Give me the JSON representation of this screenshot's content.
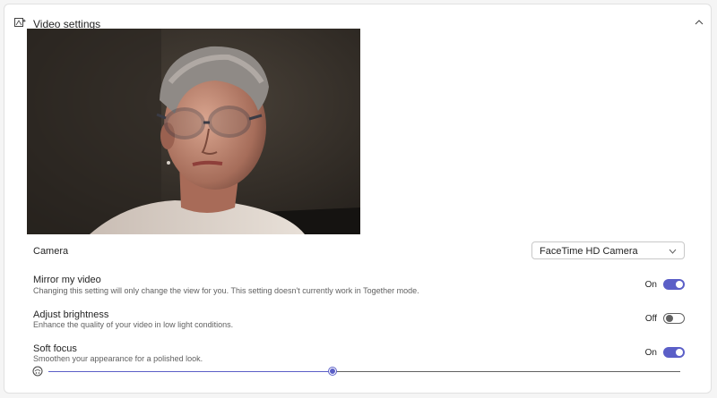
{
  "panel": {
    "title": "Video settings",
    "settings_icon": "video-effects-icon",
    "collapse_icon": "chevron-up-icon"
  },
  "camera": {
    "label": "Camera",
    "value": "FaceTime HD Camera",
    "dropdown_icon": "chevron-down-icon"
  },
  "mirror": {
    "title": "Mirror my video",
    "description": "Changing this setting will only change the view for you. This setting doesn't currently work in Together mode.",
    "state_label": "On",
    "enabled": true
  },
  "brightness": {
    "title": "Adjust brightness",
    "description": "Enhance the quality of your video in low light conditions.",
    "state_label": "Off",
    "enabled": false
  },
  "soft_focus": {
    "title": "Soft focus",
    "description": "Smoothen your appearance for a polished look.",
    "state_label": "On",
    "enabled": true,
    "level": 0.45,
    "slider_icon": "soft-focus-icon"
  },
  "colors": {
    "accent": "#5b5fc7",
    "preview_bg": "#2f2a25"
  }
}
